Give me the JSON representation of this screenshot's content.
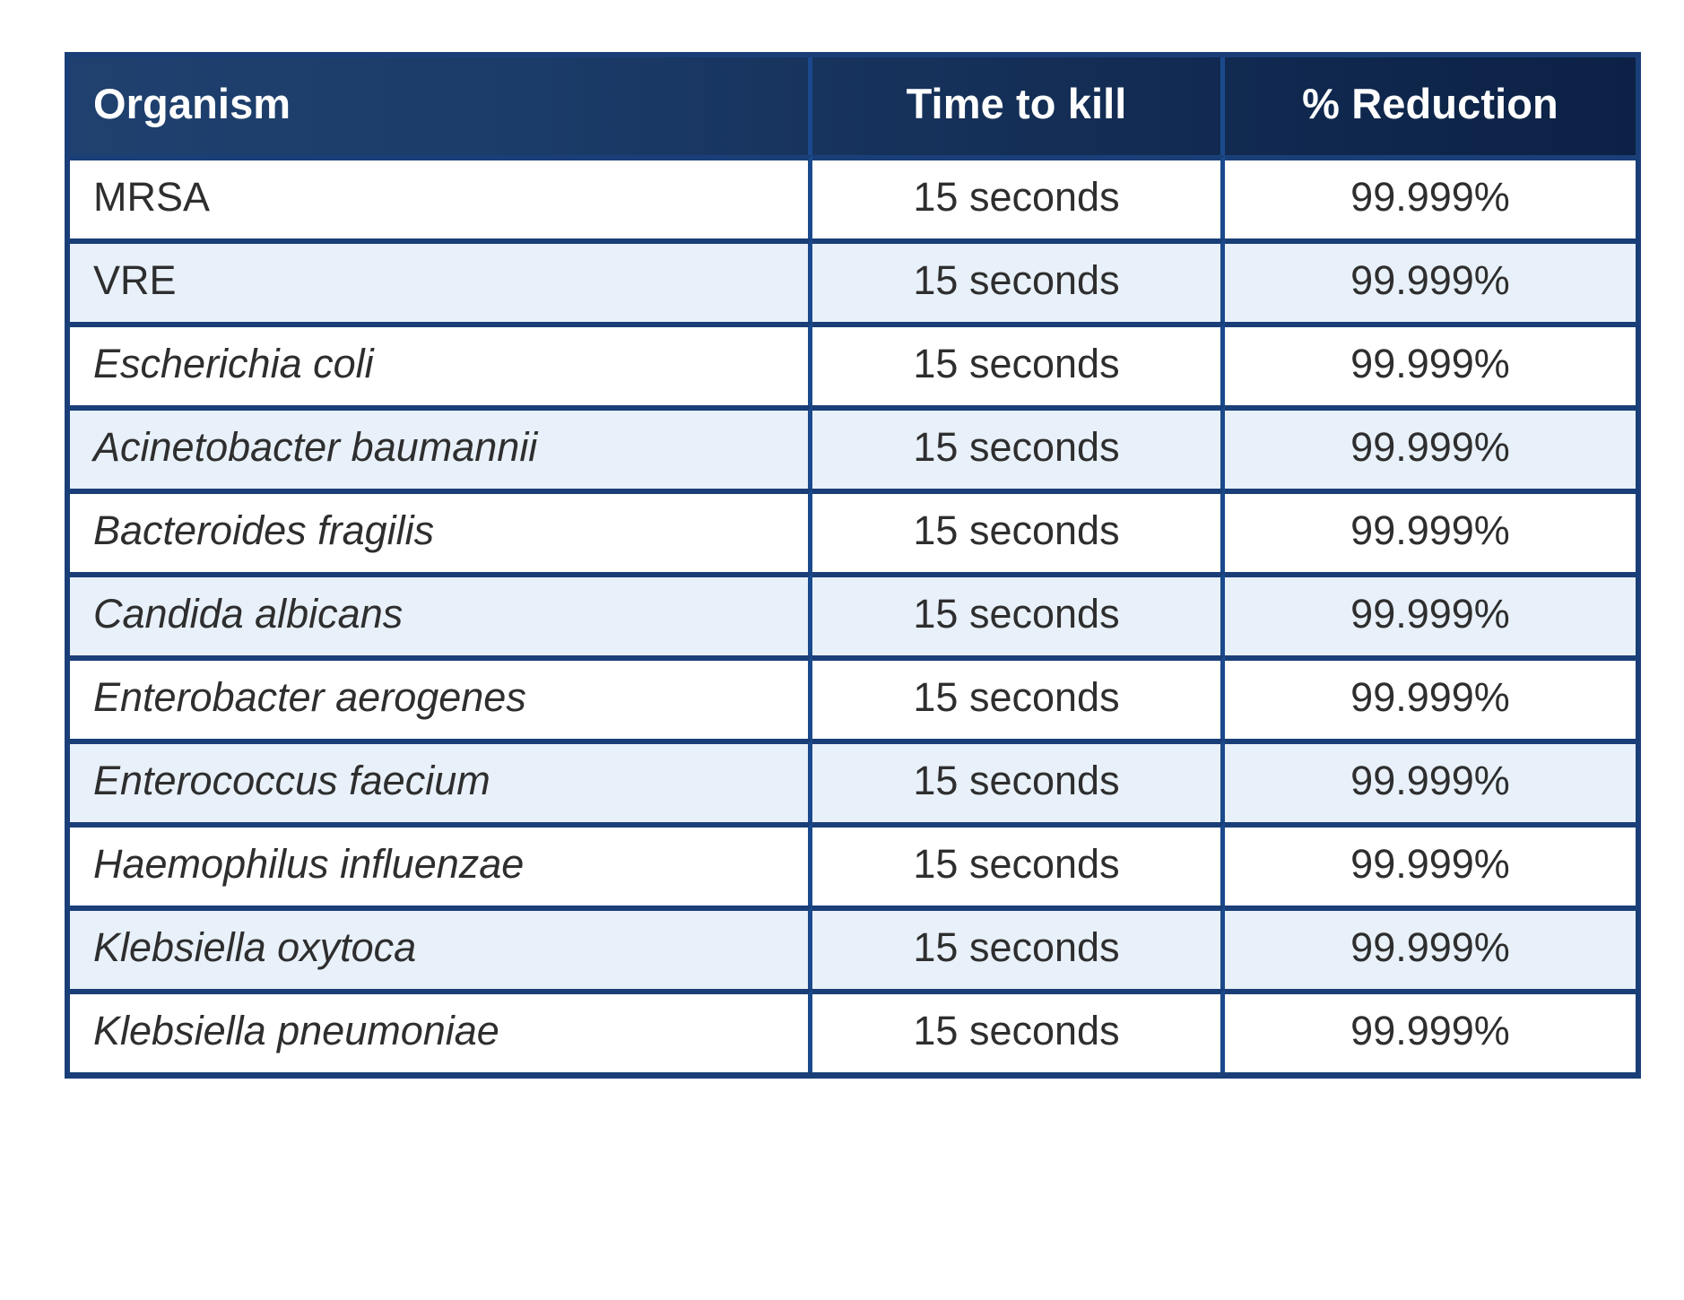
{
  "table": {
    "columns": [
      {
        "key": "organism",
        "label": "Organism",
        "align": "left"
      },
      {
        "key": "time_to_kill",
        "label": "Time to kill",
        "align": "center"
      },
      {
        "key": "pct_reduction",
        "label": "% Reduction",
        "align": "center"
      }
    ],
    "rows": [
      {
        "organism": "MRSA",
        "italic": false,
        "time_to_kill": "15 seconds",
        "pct_reduction": "99.999%"
      },
      {
        "organism": "VRE",
        "italic": false,
        "time_to_kill": "15 seconds",
        "pct_reduction": "99.999%"
      },
      {
        "organism": "Escherichia coli",
        "italic": true,
        "time_to_kill": "15 seconds",
        "pct_reduction": "99.999%"
      },
      {
        "organism": "Acinetobacter baumannii",
        "italic": true,
        "time_to_kill": "15 seconds",
        "pct_reduction": "99.999%"
      },
      {
        "organism": "Bacteroides fragilis",
        "italic": true,
        "time_to_kill": "15 seconds",
        "pct_reduction": "99.999%"
      },
      {
        "organism": "Candida albicans",
        "italic": true,
        "time_to_kill": "15 seconds",
        "pct_reduction": "99.999%"
      },
      {
        "organism": "Enterobacter aerogenes",
        "italic": true,
        "time_to_kill": "15 seconds",
        "pct_reduction": "99.999%"
      },
      {
        "organism": "Enterococcus faecium",
        "italic": true,
        "time_to_kill": "15 seconds",
        "pct_reduction": "99.999%"
      },
      {
        "organism": "Haemophilus influenzae",
        "italic": true,
        "time_to_kill": "15 seconds",
        "pct_reduction": "99.999%"
      },
      {
        "organism": "Klebsiella oxytoca",
        "italic": true,
        "time_to_kill": "15 seconds",
        "pct_reduction": "99.999%"
      },
      {
        "organism": "Klebsiella pneumoniae",
        "italic": true,
        "time_to_kill": "15 seconds",
        "pct_reduction": "99.999%"
      }
    ]
  },
  "colors": {
    "header_start": "#20416f",
    "header_end": "#0c2145",
    "border": "#1a3f78",
    "divider": "#1a4a8c",
    "row_alt": "#e8f0f9",
    "row_base": "#ffffff",
    "text": "#2e2e2e",
    "header_text": "#ffffff"
  }
}
